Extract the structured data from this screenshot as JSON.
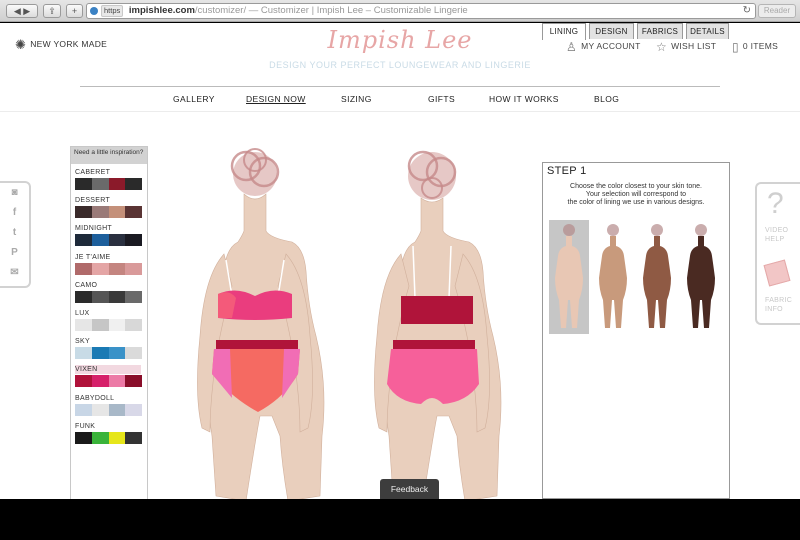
{
  "browser": {
    "url_scheme": "https",
    "url_host": "impishlee.com",
    "url_path": "/customizer/",
    "page_title": " — Customizer | Impish Lee – Customizable Lingerie",
    "reader_label": "Reader"
  },
  "header": {
    "made_label": "NEW YORK MADE",
    "logo_text": "Impish Lee",
    "tagline": "DESIGN YOUR PERFECT LOUNGEWEAR AND LINGERIE",
    "account_label": "MY ACCOUNT",
    "wishlist_label": "WISH LIST",
    "items_label": "0 ITEMS"
  },
  "nav": {
    "items": [
      {
        "label": "GALLERY"
      },
      {
        "label": "DESIGN NOW"
      },
      {
        "label": "SIZING"
      },
      {
        "label": "GIFTS"
      },
      {
        "label": "HOW IT WORKS"
      },
      {
        "label": "BLOG"
      }
    ],
    "active": "DESIGN NOW"
  },
  "social": [
    "instagram-icon",
    "facebook-icon",
    "twitter-icon",
    "pinterest-icon",
    "email-icon"
  ],
  "inspiration": {
    "title": "Need a little inspiration?",
    "selected": "VIXEN",
    "collections": [
      {
        "name": "CABERET",
        "swatches": [
          "#2a2a2a",
          "#6a6a6a",
          "#8b1a2a",
          "#2a2a2a"
        ]
      },
      {
        "name": "DESSERT",
        "swatches": [
          "#3a2a2a",
          "#9a7a78",
          "#c4907a",
          "#5a3434"
        ]
      },
      {
        "name": "MIDNIGHT",
        "swatches": [
          "#1e2a3a",
          "#1d5f9c",
          "#2a3040",
          "#1a1a22"
        ]
      },
      {
        "name": "JE T'AIME",
        "swatches": [
          "#b06a6a",
          "#e4a5a5",
          "#c48580",
          "#d99a9a"
        ]
      },
      {
        "name": "CAMO",
        "swatches": [
          "#2a2a2a",
          "#555555",
          "#3a3a3a",
          "#6a6a6a"
        ]
      },
      {
        "name": "LUX",
        "swatches": [
          "#e6e6e6",
          "#c6c6c6",
          "#f0f0f0",
          "#d8d8d8"
        ]
      },
      {
        "name": "SKY",
        "swatches": [
          "#c8dbe6",
          "#1a7ab4",
          "#3a92c8",
          "#dadada"
        ]
      },
      {
        "name": "VIXEN",
        "swatches": [
          "#b0123a",
          "#d6206a",
          "#ec7aa6",
          "#8a0e2a"
        ]
      },
      {
        "name": "BABYDOLL",
        "swatches": [
          "#c8d6e6",
          "#e6e6e6",
          "#a8b8c8",
          "#d8d8e8"
        ]
      },
      {
        "name": "FUNK",
        "swatches": [
          "#1a1a1a",
          "#3ab33a",
          "#e6e61a",
          "#333333"
        ]
      }
    ]
  },
  "tabs": [
    {
      "label": "LINING"
    },
    {
      "label": "DESIGN"
    },
    {
      "label": "FABRICS"
    },
    {
      "label": "DETAILS"
    }
  ],
  "active_tab": "LINING",
  "step": {
    "title": "STEP 1",
    "line1": "Choose the color closest to your skin tone.",
    "line2": "Your selection will correspond to",
    "line3": "the color of lining we use in various designs."
  },
  "skin_tones": [
    "#e8c7b4",
    "#c89a7c",
    "#8f5a44",
    "#4a2a22"
  ],
  "selected_tone": 0,
  "colors": {
    "skin": "#e9cfbd",
    "hair": "#c99a9a",
    "bra_front": "#ea3d7e",
    "bra_cup": "#f45a7a",
    "band": "#b0143a",
    "panty_front": "#f56a62",
    "lace": "#f16db5",
    "bra_back": "#b0143a",
    "panty_back": "#f6609a"
  },
  "help": {
    "video_label_1": "VIDEO",
    "video_label_2": "HELP",
    "fabric_label_1": "FABRIC",
    "fabric_label_2": "INFO"
  },
  "feedback_label": "Feedback"
}
